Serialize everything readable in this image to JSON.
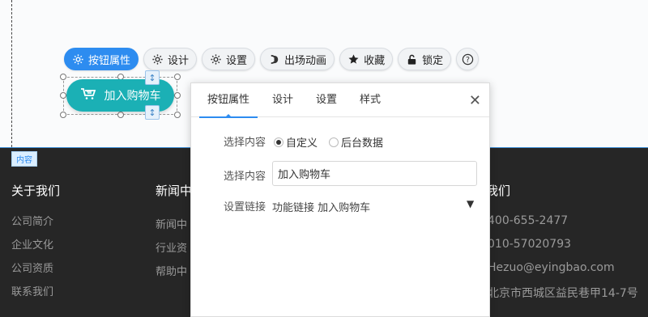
{
  "toolbar": {
    "buttons": [
      {
        "label": "按钮属性",
        "icon": "gear-icon"
      },
      {
        "label": "设计",
        "icon": "gear-icon"
      },
      {
        "label": "设置",
        "icon": "gear-icon"
      },
      {
        "label": "出场动画",
        "icon": "animation-icon"
      },
      {
        "label": "收藏",
        "icon": "star-icon"
      },
      {
        "label": "锁定",
        "icon": "unlock-icon"
      },
      {
        "label": "?",
        "icon": "help-icon"
      }
    ],
    "active_color": "#2d8cf0"
  },
  "element": {
    "cart_label": "加入购物车",
    "cart_color": "#1bb0b5",
    "resize_glyph": "↕"
  },
  "footer": {
    "tag": "内容",
    "col1": {
      "title": "关于我们",
      "items": [
        "公司简介",
        "企业文化",
        "公司资质",
        "联系我们"
      ]
    },
    "col2": {
      "title": "新闻中",
      "items": [
        "新闻中",
        "行业资",
        "帮助中"
      ]
    },
    "col3": {
      "title": "我们",
      "items": [
        "400-655-2477",
        "010-57020793",
        "Hezuo@eyingbao.com",
        "北京市西城区益民巷甲14-7号"
      ]
    }
  },
  "panel": {
    "tabs": [
      "按钮属性",
      "设计",
      "设置",
      "样式"
    ],
    "active_tab": "按钮属性",
    "close": "✕",
    "content_label": "选择内容",
    "radio_options": [
      "自定义",
      "后台数据"
    ],
    "radio_selected": "自定义",
    "input_label": "选择内容",
    "input_value": "加入购物车",
    "link_label": "设置链接",
    "link_value": "功能链接 加入购物车",
    "link_arrow": "▼"
  }
}
